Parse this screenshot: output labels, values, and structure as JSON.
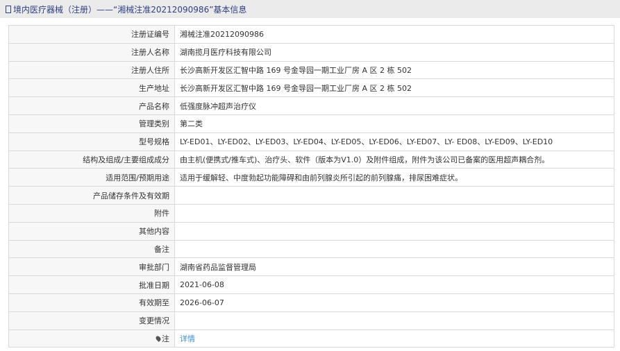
{
  "header": {
    "title": "境内医疗器械（注册）——“湘械注准20212090986”基本信息"
  },
  "rows": [
    {
      "label": "注册证编号",
      "value": "湘械注准20212090986"
    },
    {
      "label": "注册人名称",
      "value": "湖南揽月医疗科技有限公司"
    },
    {
      "label": "注册人住所",
      "value": "长沙高新开发区汇智中路 169 号金导园一期工业厂房 A 区 2 栋 502"
    },
    {
      "label": "生产地址",
      "value": "长沙高新开发区汇智中路 169 号金导园一期工业厂房 A 区 2 栋 502"
    },
    {
      "label": "产品名称",
      "value": "低强度脉冲超声治疗仪"
    },
    {
      "label": "管理类别",
      "value": "第二类"
    },
    {
      "label": "型号规格",
      "value": "LY-ED01、LY-ED02、LY-ED03、LY-ED04、LY-ED05、LY-ED06、LY-ED07、LY- ED08、LY-ED09、LY-ED10"
    },
    {
      "label": "结构及组成/主要组成成分",
      "value": "由主机(便携式/推车式)、治疗头、软件（版本为V1.0）及附件组成，附件为该公司已备案的医用超声耦合剂。"
    },
    {
      "label": "适用范围/预期用途",
      "value": "适用于缓解轻、中度勃起功能障碍和由前列腺炎所引起的前列腺痛，排尿困难症状。"
    },
    {
      "label": "产品储存条件及有效期",
      "value": ""
    },
    {
      "label": "附件",
      "value": ""
    },
    {
      "label": "其他内容",
      "value": ""
    },
    {
      "label": "备注",
      "value": ""
    },
    {
      "label": "审批部门",
      "value": "湖南省药品监督管理局"
    },
    {
      "label": "批准日期",
      "value": "2021-06-08"
    },
    {
      "label": "有效期至",
      "value": "2026-06-07"
    },
    {
      "label": "变更情况",
      "value": ""
    }
  ],
  "note": {
    "label": "注",
    "link": "详情"
  }
}
